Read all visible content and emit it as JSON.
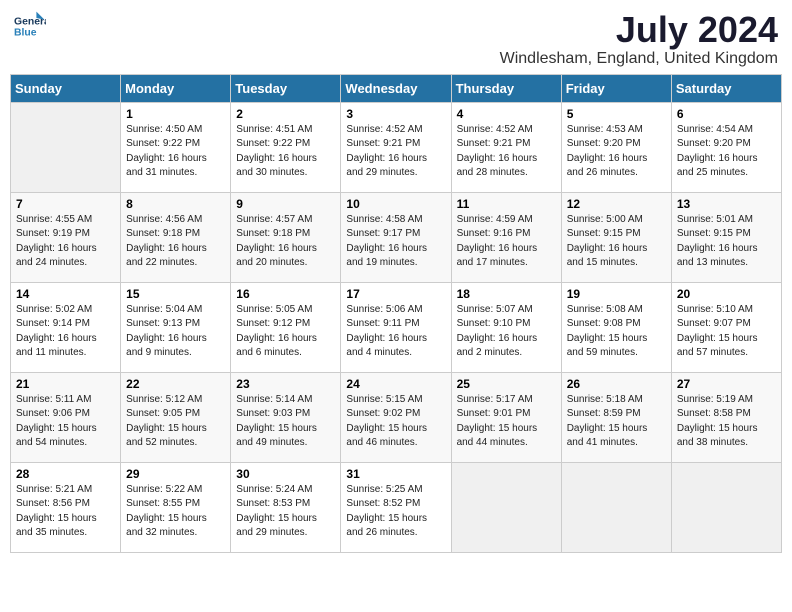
{
  "header": {
    "logo_line1": "General",
    "logo_line2": "Blue",
    "month_year": "July 2024",
    "location": "Windlesham, England, United Kingdom"
  },
  "weekdays": [
    "Sunday",
    "Monday",
    "Tuesday",
    "Wednesday",
    "Thursday",
    "Friday",
    "Saturday"
  ],
  "weeks": [
    [
      {
        "day": "",
        "info": ""
      },
      {
        "day": "1",
        "info": "Sunrise: 4:50 AM\nSunset: 9:22 PM\nDaylight: 16 hours\nand 31 minutes."
      },
      {
        "day": "2",
        "info": "Sunrise: 4:51 AM\nSunset: 9:22 PM\nDaylight: 16 hours\nand 30 minutes."
      },
      {
        "day": "3",
        "info": "Sunrise: 4:52 AM\nSunset: 9:21 PM\nDaylight: 16 hours\nand 29 minutes."
      },
      {
        "day": "4",
        "info": "Sunrise: 4:52 AM\nSunset: 9:21 PM\nDaylight: 16 hours\nand 28 minutes."
      },
      {
        "day": "5",
        "info": "Sunrise: 4:53 AM\nSunset: 9:20 PM\nDaylight: 16 hours\nand 26 minutes."
      },
      {
        "day": "6",
        "info": "Sunrise: 4:54 AM\nSunset: 9:20 PM\nDaylight: 16 hours\nand 25 minutes."
      }
    ],
    [
      {
        "day": "7",
        "info": "Sunrise: 4:55 AM\nSunset: 9:19 PM\nDaylight: 16 hours\nand 24 minutes."
      },
      {
        "day": "8",
        "info": "Sunrise: 4:56 AM\nSunset: 9:18 PM\nDaylight: 16 hours\nand 22 minutes."
      },
      {
        "day": "9",
        "info": "Sunrise: 4:57 AM\nSunset: 9:18 PM\nDaylight: 16 hours\nand 20 minutes."
      },
      {
        "day": "10",
        "info": "Sunrise: 4:58 AM\nSunset: 9:17 PM\nDaylight: 16 hours\nand 19 minutes."
      },
      {
        "day": "11",
        "info": "Sunrise: 4:59 AM\nSunset: 9:16 PM\nDaylight: 16 hours\nand 17 minutes."
      },
      {
        "day": "12",
        "info": "Sunrise: 5:00 AM\nSunset: 9:15 PM\nDaylight: 16 hours\nand 15 minutes."
      },
      {
        "day": "13",
        "info": "Sunrise: 5:01 AM\nSunset: 9:15 PM\nDaylight: 16 hours\nand 13 minutes."
      }
    ],
    [
      {
        "day": "14",
        "info": "Sunrise: 5:02 AM\nSunset: 9:14 PM\nDaylight: 16 hours\nand 11 minutes."
      },
      {
        "day": "15",
        "info": "Sunrise: 5:04 AM\nSunset: 9:13 PM\nDaylight: 16 hours\nand 9 minutes."
      },
      {
        "day": "16",
        "info": "Sunrise: 5:05 AM\nSunset: 9:12 PM\nDaylight: 16 hours\nand 6 minutes."
      },
      {
        "day": "17",
        "info": "Sunrise: 5:06 AM\nSunset: 9:11 PM\nDaylight: 16 hours\nand 4 minutes."
      },
      {
        "day": "18",
        "info": "Sunrise: 5:07 AM\nSunset: 9:10 PM\nDaylight: 16 hours\nand 2 minutes."
      },
      {
        "day": "19",
        "info": "Sunrise: 5:08 AM\nSunset: 9:08 PM\nDaylight: 15 hours\nand 59 minutes."
      },
      {
        "day": "20",
        "info": "Sunrise: 5:10 AM\nSunset: 9:07 PM\nDaylight: 15 hours\nand 57 minutes."
      }
    ],
    [
      {
        "day": "21",
        "info": "Sunrise: 5:11 AM\nSunset: 9:06 PM\nDaylight: 15 hours\nand 54 minutes."
      },
      {
        "day": "22",
        "info": "Sunrise: 5:12 AM\nSunset: 9:05 PM\nDaylight: 15 hours\nand 52 minutes."
      },
      {
        "day": "23",
        "info": "Sunrise: 5:14 AM\nSunset: 9:03 PM\nDaylight: 15 hours\nand 49 minutes."
      },
      {
        "day": "24",
        "info": "Sunrise: 5:15 AM\nSunset: 9:02 PM\nDaylight: 15 hours\nand 46 minutes."
      },
      {
        "day": "25",
        "info": "Sunrise: 5:17 AM\nSunset: 9:01 PM\nDaylight: 15 hours\nand 44 minutes."
      },
      {
        "day": "26",
        "info": "Sunrise: 5:18 AM\nSunset: 8:59 PM\nDaylight: 15 hours\nand 41 minutes."
      },
      {
        "day": "27",
        "info": "Sunrise: 5:19 AM\nSunset: 8:58 PM\nDaylight: 15 hours\nand 38 minutes."
      }
    ],
    [
      {
        "day": "28",
        "info": "Sunrise: 5:21 AM\nSunset: 8:56 PM\nDaylight: 15 hours\nand 35 minutes."
      },
      {
        "day": "29",
        "info": "Sunrise: 5:22 AM\nSunset: 8:55 PM\nDaylight: 15 hours\nand 32 minutes."
      },
      {
        "day": "30",
        "info": "Sunrise: 5:24 AM\nSunset: 8:53 PM\nDaylight: 15 hours\nand 29 minutes."
      },
      {
        "day": "31",
        "info": "Sunrise: 5:25 AM\nSunset: 8:52 PM\nDaylight: 15 hours\nand 26 minutes."
      },
      {
        "day": "",
        "info": ""
      },
      {
        "day": "",
        "info": ""
      },
      {
        "day": "",
        "info": ""
      }
    ]
  ]
}
